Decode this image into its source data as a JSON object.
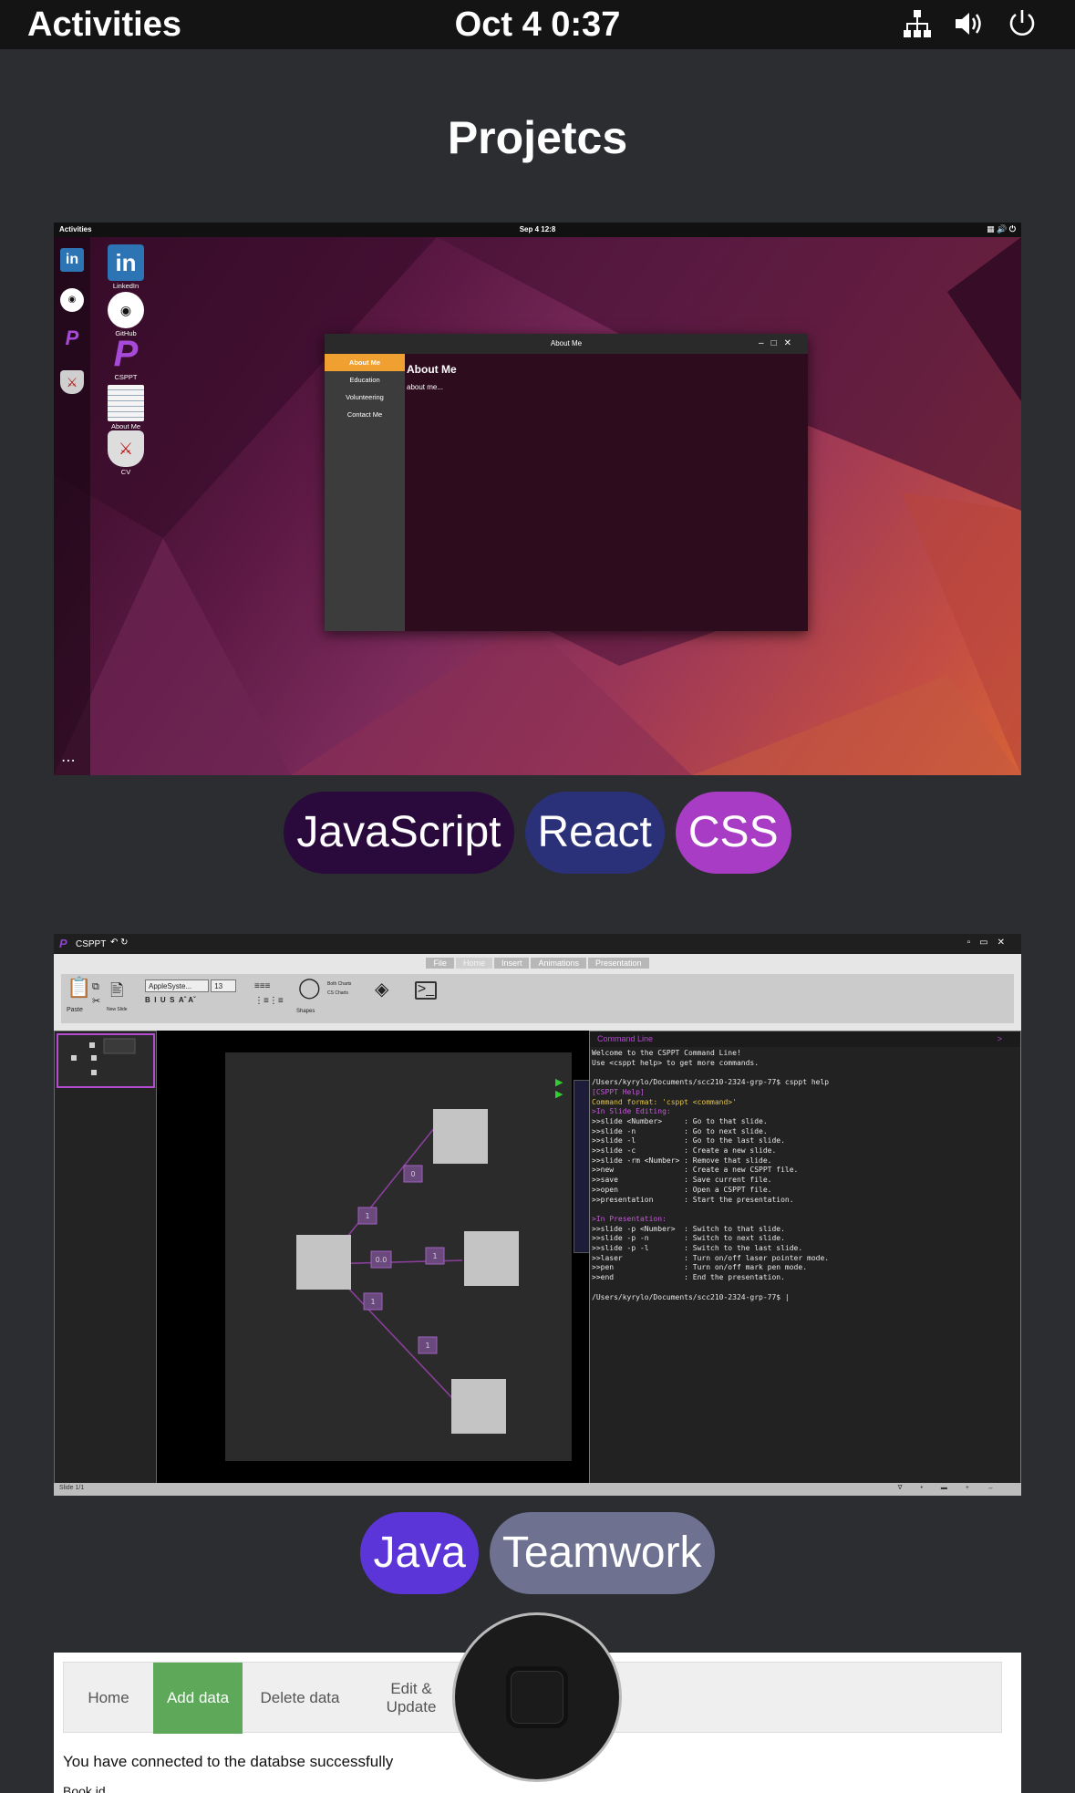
{
  "topbar": {
    "activities": "Activities",
    "clock": "Oct 4  0:37"
  },
  "page": {
    "title": "Projetcs"
  },
  "project1": {
    "screenshot": {
      "topbar_left": "Activities",
      "topbar_center": "Sep 4  12:8",
      "desktop_icons": [
        "LinkedIn",
        "GitHub",
        "CSPPT",
        "About Me",
        "CV"
      ],
      "window_title": "About Me",
      "window_menu": [
        "About Me",
        "Education",
        "Volunteering",
        "Contact Me"
      ],
      "window_heading": "About Me",
      "window_body": "about me..."
    },
    "tags": [
      {
        "label": "JavaScript",
        "color": "#2a0a3c"
      },
      {
        "label": "React",
        "color": "#2b3178"
      },
      {
        "label": "CSS",
        "color": "#a83cc4"
      }
    ]
  },
  "project2": {
    "screenshot": {
      "app_title": "CSPPT",
      "ribbon_tabs": [
        "File",
        "Home",
        "Insert",
        "Animations",
        "Presentation"
      ],
      "font_name": "AppleSyste...",
      "font_size": "13",
      "paste_label": "Paste",
      "new_slide_label": "New Slide",
      "shapes_label": "Shapes",
      "chart_labels": [
        "Both Charts",
        "CS Charts"
      ],
      "terminal_title": "Command Line",
      "terminal_lines": [
        "Welcome to the CSPPT Command Line!",
        "Use <csppt help> to get more commands.",
        "",
        "/Users/kyrylo/Documents/scc210-2324-grp-77$ csppt help",
        "[CSPPT Help]",
        "Command format: 'csppt <command>'",
        ">In Slide Editing:",
        ">>slide <Number>     : Go to that slide.",
        ">>slide -n           : Go to next slide.",
        ">>slide -l           : Go to the last slide.",
        ">>slide -c           : Create a new slide.",
        ">>slide -rm <Number> : Remove that slide.",
        ">>new                : Create a new CSPPT file.",
        ">>save               : Save current file.",
        ">>open               : Open a CSPPT file.",
        ">>presentation       : Start the presentation.",
        "",
        ">In Presentation:",
        ">>slide -p <Number>  : Switch to that slide.",
        ">>slide -p -n        : Switch to next slide.",
        ">>slide -p -l        : Switch to the last slide.",
        ">>laser              : Turn on/off laser pointer mode.",
        ">>pen                : Turn on/off mark pen mode.",
        ">>end                : End the presentation.",
        "",
        "/Users/kyrylo/Documents/scc210-2324-grp-77$ |"
      ],
      "diagram_labels": [
        "0",
        "1",
        "0.0",
        "1",
        "1",
        "1"
      ],
      "status_left": "Slide 1/1"
    },
    "tags": [
      {
        "label": "Java",
        "color": "#5b35d8"
      },
      {
        "label": "Teamwork",
        "color": "#6e7190"
      }
    ]
  },
  "project3": {
    "nav": [
      "Home",
      "Add data",
      "Delete data",
      "Edit & Update"
    ],
    "message": "You have connected to the databse successfully",
    "cut_text": "Book id"
  }
}
